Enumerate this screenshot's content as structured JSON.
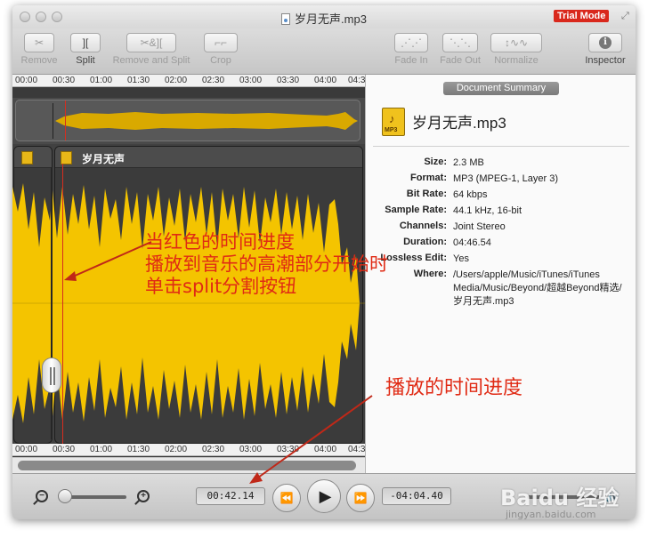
{
  "window": {
    "title": "岁月无声.mp3",
    "trial_badge": "Trial Mode",
    "fullscreen_glyph": "⤢"
  },
  "toolbar": {
    "remove": {
      "icon": "✂",
      "label": "Remove"
    },
    "split": {
      "icon": "][",
      "label": "Split"
    },
    "remove_and_split": {
      "icon": "✂&][",
      "label": "Remove and Split"
    },
    "crop": {
      "icon": "⌐⌐",
      "label": "Crop"
    },
    "fade_in": {
      "icon": "⋰⋰",
      "label": "Fade In"
    },
    "fade_out": {
      "icon": "⋱⋱",
      "label": "Fade Out"
    },
    "normalize": {
      "icon": "↕∿∿",
      "label": "Normalize"
    },
    "inspector": {
      "icon": "i",
      "label": "Inspector"
    }
  },
  "timeline": {
    "ticks": [
      "00:00",
      "00:30",
      "01:00",
      "01:30",
      "02:00",
      "02:30",
      "03:00",
      "03:30",
      "04:00",
      "04:3"
    ]
  },
  "clips": [
    {
      "name": ""
    },
    {
      "name": "岁月无声"
    }
  ],
  "summary": {
    "tab_label": "Document Summary",
    "file_title": "岁月无声.mp3",
    "file_icon_label": "MP3",
    "rows": [
      {
        "key": "Size:",
        "value": "2.3 MB"
      },
      {
        "key": "Format:",
        "value": "MP3 (MPEG-1, Layer 3)"
      },
      {
        "key": "Bit Rate:",
        "value": "64 kbps"
      },
      {
        "key": "Sample Rate:",
        "value": "44.1 kHz, 16-bit"
      },
      {
        "key": "Channels:",
        "value": "Joint Stereo"
      },
      {
        "key": "Duration:",
        "value": "04:46.54"
      },
      {
        "key": "Lossless Edit:",
        "value": "Yes"
      },
      {
        "key": "Where:",
        "value": "/Users/apple/Music/iTunes/iTunes Media/Music/Beyond/超越Beyond精选/岁月无声.mp3"
      }
    ]
  },
  "transport": {
    "elapsed": "00:42.14",
    "remaining": "-04:04.40",
    "rewind_icon": "⏪",
    "play_icon": "▶",
    "forward_icon": "⏩",
    "zoom_out_icon": "−",
    "zoom_in_icon": "+",
    "volume_icon": "🔊",
    "zoom_level": 0.05
  },
  "annotations": {
    "line1": "当红色的时间进度",
    "line2": "播放到音乐的高潮部分开始时",
    "line3": "单击split分割按钮",
    "progress_note": "播放的时间进度",
    "arrow_color": "#c02818"
  },
  "watermark": {
    "brand": "Baidu 经验",
    "url": "jingyan.baidu.com"
  },
  "colors": {
    "waveform": "#f4c400",
    "playhead": "#d62d1f",
    "trial_badge": "#d9281c"
  }
}
